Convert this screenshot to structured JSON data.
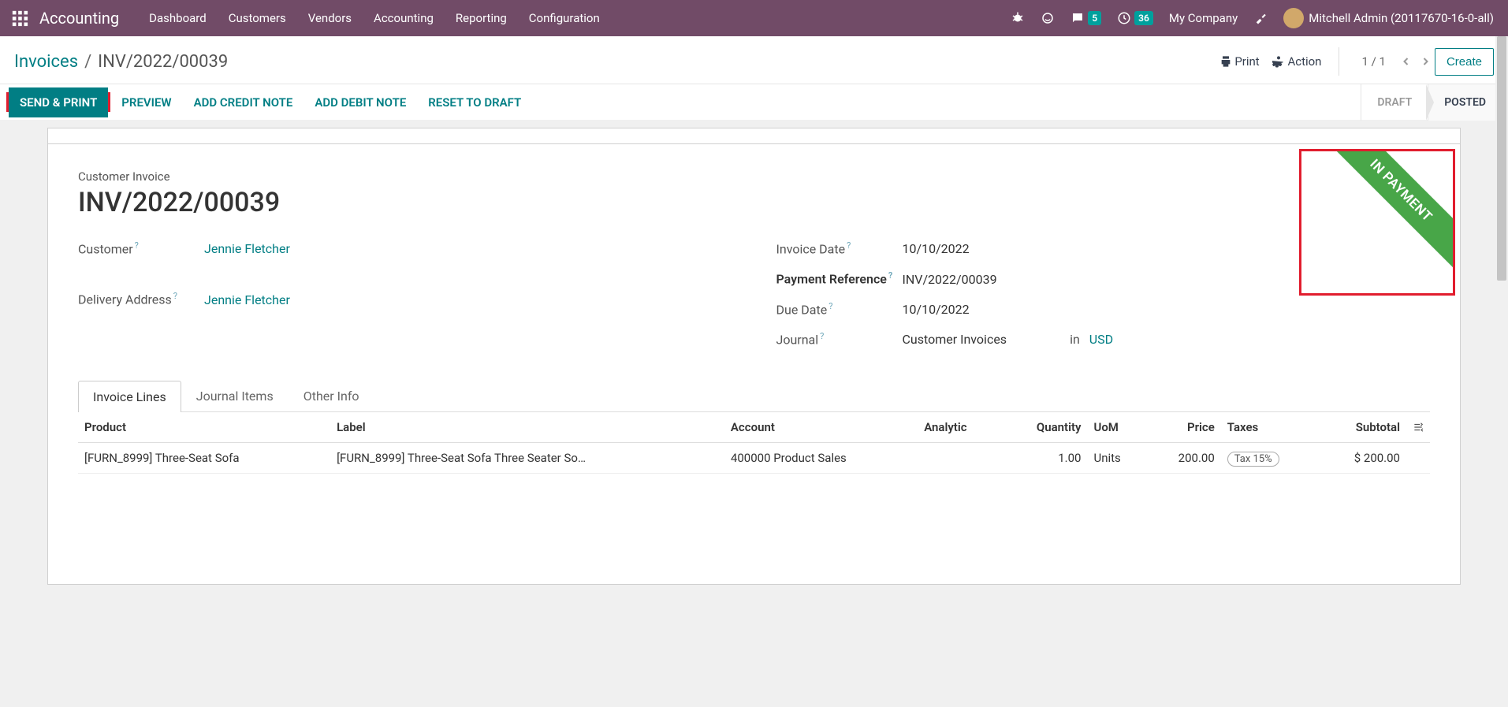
{
  "nav": {
    "app_title": "Accounting",
    "links": [
      "Dashboard",
      "Customers",
      "Vendors",
      "Accounting",
      "Reporting",
      "Configuration"
    ],
    "chat_badge": "5",
    "clock_badge": "36",
    "company": "My Company",
    "user": "Mitchell Admin (20117670-16-0-all)"
  },
  "breadcrumb": {
    "root": "Invoices",
    "current": "INV/2022/00039"
  },
  "controls": {
    "print": "Print",
    "action": "Action",
    "pager": "1 / 1",
    "create": "Create"
  },
  "actions": {
    "send_print": "Send & Print",
    "preview": "Preview",
    "credit_note": "Add Credit Note",
    "debit_note": "Add Debit Note",
    "reset_draft": "Reset to Draft"
  },
  "status": {
    "draft": "Draft",
    "posted": "Posted"
  },
  "ribbon": "In Payment",
  "sheet": {
    "type_label": "Customer Invoice",
    "title": "INV/2022/00039",
    "fields": {
      "customer_label": "Customer",
      "customer_value": "Jennie Fletcher",
      "delivery_label": "Delivery Address",
      "delivery_value": "Jennie Fletcher",
      "invoice_date_label": "Invoice Date",
      "invoice_date_value": "10/10/2022",
      "payment_ref_label": "Payment Reference",
      "payment_ref_value": "INV/2022/00039",
      "due_date_label": "Due Date",
      "due_date_value": "10/10/2022",
      "journal_label": "Journal",
      "journal_value": "Customer Invoices",
      "journal_in": "in",
      "journal_currency": "USD"
    }
  },
  "tabs": [
    "Invoice Lines",
    "Journal Items",
    "Other Info"
  ],
  "table": {
    "headers": {
      "product": "Product",
      "label": "Label",
      "account": "Account",
      "analytic": "Analytic",
      "quantity": "Quantity",
      "uom": "UoM",
      "price": "Price",
      "taxes": "Taxes",
      "subtotal": "Subtotal"
    },
    "rows": [
      {
        "product": "[FURN_8999] Three-Seat Sofa",
        "label": "[FURN_8999] Three-Seat Sofa Three Seater So…",
        "account": "400000 Product Sales",
        "analytic": "",
        "quantity": "1.00",
        "uom": "Units",
        "price": "200.00",
        "tax": "Tax 15%",
        "subtotal": "$ 200.00"
      }
    ]
  }
}
